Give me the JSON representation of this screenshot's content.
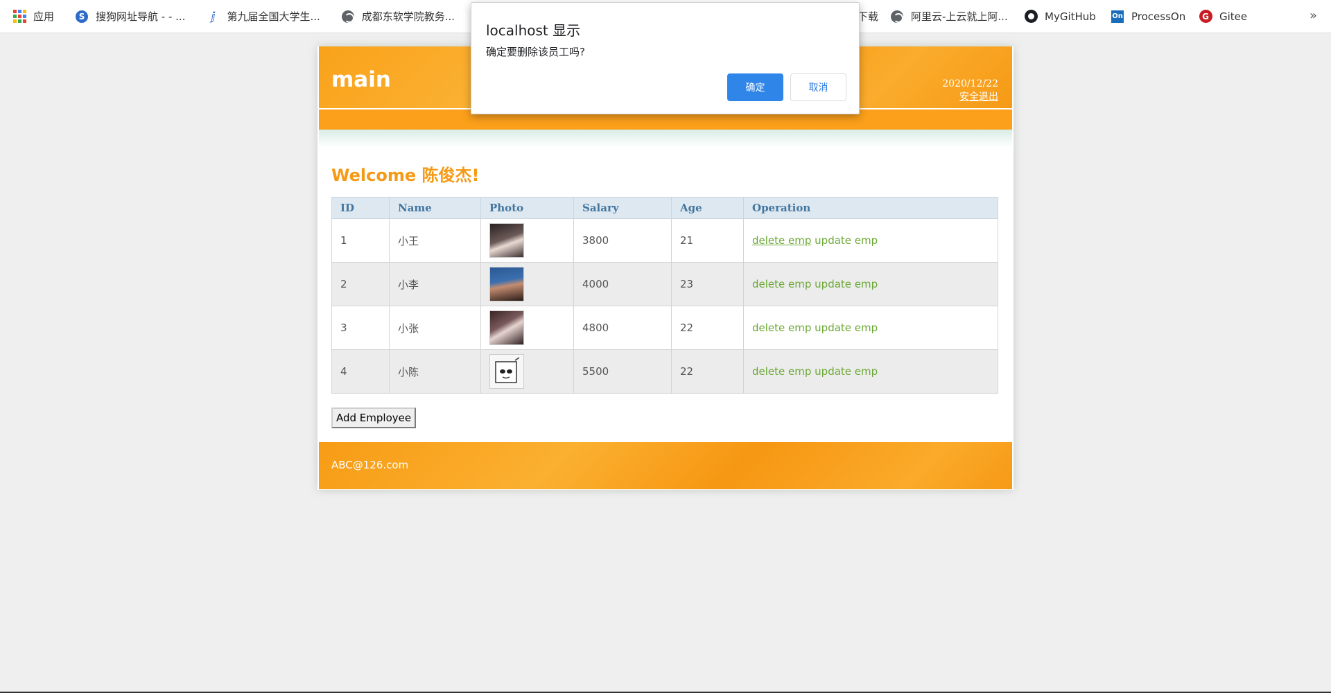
{
  "bookmarks": {
    "items": [
      {
        "label": "应用",
        "icon": "apps-grid-icon"
      },
      {
        "label": "搜狗网址导航 - - ...",
        "icon": "sogou-icon"
      },
      {
        "label": "第九届全国大学生...",
        "icon": "ink-icon"
      },
      {
        "label": "成都东软学院教务...",
        "icon": "globe-icon"
      },
      {
        "label": "下载",
        "icon": "globe-icon"
      },
      {
        "label": "阿里云-上云就上阿...",
        "icon": "globe-icon"
      },
      {
        "label": "MyGitHub",
        "icon": "github-icon"
      },
      {
        "label": "ProcessOn",
        "icon": "processon-icon"
      },
      {
        "label": "Gitee",
        "icon": "gitee-icon"
      }
    ],
    "more": "»"
  },
  "header": {
    "logo": "main",
    "date": "2020/12/22",
    "logout": "安全退出"
  },
  "welcome": "Welcome 陈俊杰!",
  "table": {
    "columns": [
      "ID",
      "Name",
      "Photo",
      "Salary",
      "Age",
      "Operation"
    ],
    "rows": [
      {
        "id": "1",
        "name": "小王",
        "salary": "3800",
        "age": "21",
        "photo_color": "#4a3a3a"
      },
      {
        "id": "2",
        "name": "小李",
        "salary": "4000",
        "age": "23",
        "photo_color": "#2f5f9a"
      },
      {
        "id": "3",
        "name": "小张",
        "salary": "4800",
        "age": "22",
        "photo_color": "#5a3a3e"
      },
      {
        "id": "4",
        "name": "小陈",
        "salary": "5500",
        "age": "22",
        "photo_color": "#f4f4f4"
      }
    ],
    "delete_label": "delete emp",
    "update_label": "update emp"
  },
  "add_button": "Add Employee",
  "footer": "ABC@126.com",
  "dialog": {
    "title": "localhost 显示",
    "message": "确定要删除该员工吗?",
    "ok": "确定",
    "cancel": "取消"
  },
  "colors": {
    "accent_orange": "#f59a16",
    "link_green": "#6ba834",
    "header_blue": "#43769f",
    "dialog_blue": "#2f86e8"
  }
}
